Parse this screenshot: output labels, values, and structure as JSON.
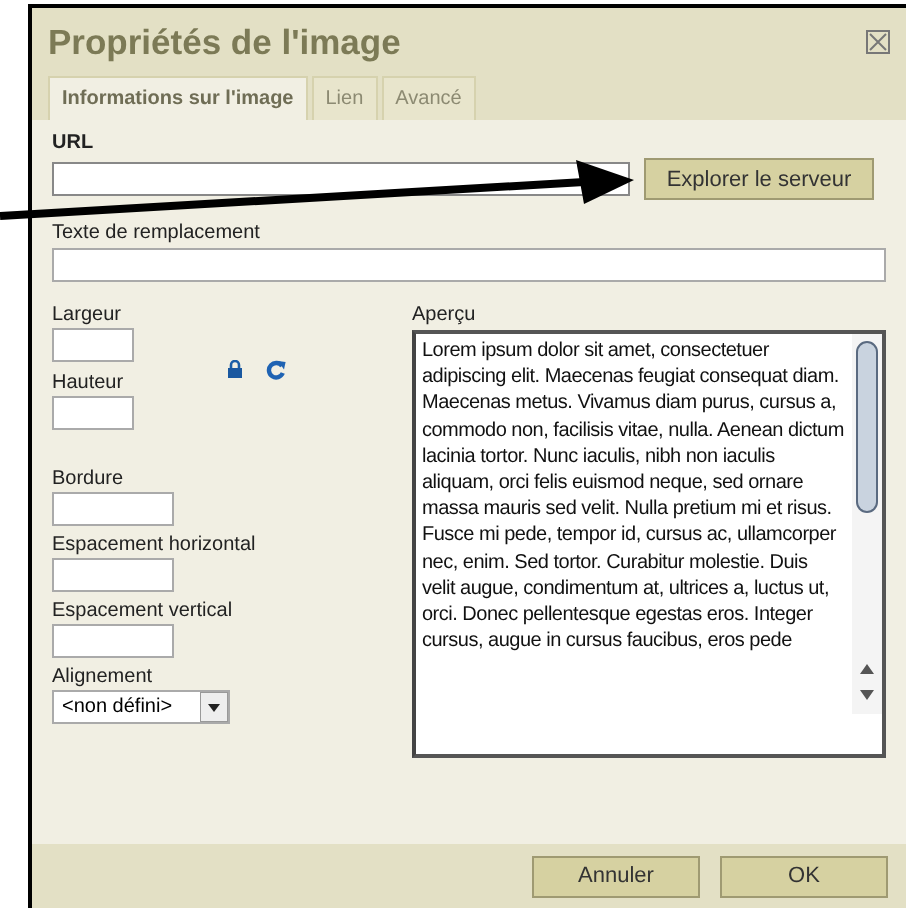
{
  "dialog": {
    "title": "Propriétés de l'image",
    "tabs": [
      {
        "label": "Informations sur l'image",
        "selected": true
      },
      {
        "label": "Lien",
        "selected": false
      },
      {
        "label": "Avancé",
        "selected": false
      }
    ],
    "url_label": "URL",
    "browse_button": "Explorer le serveur",
    "alt_label": "Texte de remplacement",
    "size_fields": [
      {
        "label": "Largeur"
      },
      {
        "label": "Hauteur"
      }
    ],
    "spacing_fields": [
      {
        "label": "Bordure"
      },
      {
        "label": "Espacement horizontal"
      },
      {
        "label": "Espacement vertical"
      }
    ],
    "alignment": {
      "label": "Alignement",
      "value": "<non défini>"
    },
    "preview": {
      "label": "Aperçu",
      "text": "Lorem ipsum dolor sit amet, consectetuer adipiscing elit. Maecenas feugiat consequat diam. Maecenas metus. Vivamus diam purus, cursus a, commodo non, facilisis vitae, nulla. Aenean dictum lacinia tortor. Nunc iaculis, nibh non iaculis aliquam, orci felis euismod neque, sed ornare massa mauris sed velit. Nulla pretium mi et risus. Fusce mi pede, tempor id, cursus ac, ullamcorper nec, enim. Sed tortor. Curabitur molestie. Duis velit augue, condimentum at, ultrices a, luctus ut, orci. Donec pellentesque egestas eros. Integer cursus, augue in cursus faucibus, eros pede"
    },
    "buttons": [
      "Annuler",
      "OK"
    ]
  }
}
